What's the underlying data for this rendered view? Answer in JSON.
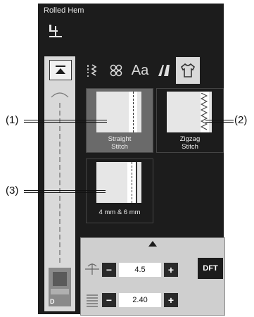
{
  "header": {
    "title": "Rolled Hem"
  },
  "stitches": [
    {
      "label_line1": "Straight",
      "label_line2": "Stitch",
      "callout": "(1)"
    },
    {
      "label_line1": "Zigzag",
      "label_line2": "Stitch",
      "callout": "(2)"
    },
    {
      "label_line1": "4 mm & 6 mm",
      "label_line2": "",
      "callout": "(3)"
    }
  ],
  "tabs": [
    "utility-stitch-icon",
    "decorative-stitch-icon",
    "alphabet",
    "quilt-icon",
    "garment-icon"
  ],
  "tab_text": {
    "alphabet": "Aa"
  },
  "settings": {
    "width_value": "4.5",
    "length_value": "2.40",
    "minus": "−",
    "plus": "+",
    "dft_label": "DFT"
  },
  "presser_foot": {
    "label": "D"
  },
  "colors": {
    "screen": "#1c1c1c",
    "panel": "#cfcfcf",
    "highlight": "#d9d9d9"
  }
}
